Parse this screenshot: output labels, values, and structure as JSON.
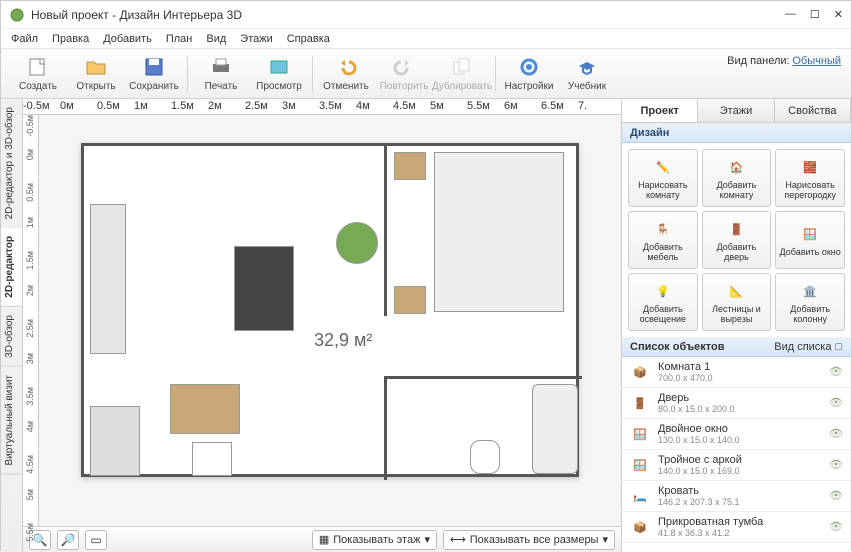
{
  "window": {
    "title": "Новый проект - Дизайн Интерьера 3D"
  },
  "menu": [
    "Файл",
    "Правка",
    "Добавить",
    "План",
    "Вид",
    "Этажи",
    "Справка"
  ],
  "toolbar": {
    "create": "Создать",
    "open": "Открыть",
    "save": "Сохранить",
    "print": "Печать",
    "view": "Просмотр",
    "undo": "Отменить",
    "redo": "Повторить",
    "dup": "Дублировать",
    "settings": "Настройки",
    "tutorial": "Учебник",
    "panel_label": "Вид панели:",
    "panel_mode": "Обычный"
  },
  "ltabs": {
    "t1": "2D-редактор и 3D-обзор",
    "t2": "2D-редактор",
    "t3": "3D-обзор",
    "t4": "Виртуальный визит"
  },
  "ruler_h": [
    "-0.5м",
    "0м",
    "0.5м",
    "1м",
    "1.5м",
    "2м",
    "2.5м",
    "3м",
    "3.5м",
    "4м",
    "4.5м",
    "5м",
    "5.5м",
    "6м",
    "6.5м",
    "7."
  ],
  "ruler_v": [
    "-0.5м",
    "0м",
    "0.5м",
    "1м",
    "1.5м",
    "2м",
    "2.5м",
    "3м",
    "3.5м",
    "4м",
    "4.5м",
    "5м",
    "5.5м"
  ],
  "area": "32,9 м²",
  "bottom": {
    "show_floor": "Показывать этаж",
    "show_sizes": "Показывать все размеры"
  },
  "rtabs": {
    "project": "Проект",
    "floors": "Этажи",
    "props": "Свойства"
  },
  "design_hdr": "Дизайн",
  "grid": [
    {
      "k": "draw_room",
      "l": "Нарисовать комнату"
    },
    {
      "k": "add_room",
      "l": "Добавить комнату"
    },
    {
      "k": "draw_wall",
      "l": "Нарисовать перегородку"
    },
    {
      "k": "add_furn",
      "l": "Добавить мебель"
    },
    {
      "k": "add_door",
      "l": "Добавить дверь"
    },
    {
      "k": "add_window",
      "l": "Добавить окно"
    },
    {
      "k": "add_light",
      "l": "Добавить освещение"
    },
    {
      "k": "stairs",
      "l": "Лестницы и вырезы"
    },
    {
      "k": "add_col",
      "l": "Добавить колонну"
    }
  ],
  "objlist_hdr": "Список объектов",
  "objlist_view": "Вид списка",
  "objects": [
    {
      "n": "Комната 1",
      "d": "700.0 x 470.0"
    },
    {
      "n": "Дверь",
      "d": "80.0 x 15.0 x 200.0"
    },
    {
      "n": "Двойное окно",
      "d": "130.0 x 15.0 x 140.0"
    },
    {
      "n": "Тройное с аркой",
      "d": "140.0 x 15.0 x 169.0"
    },
    {
      "n": "Кровать",
      "d": "146.2 x 207.3 x 75.1"
    },
    {
      "n": "Прикроватная тумба",
      "d": "41.8 x 36.3 x 41.2"
    }
  ]
}
